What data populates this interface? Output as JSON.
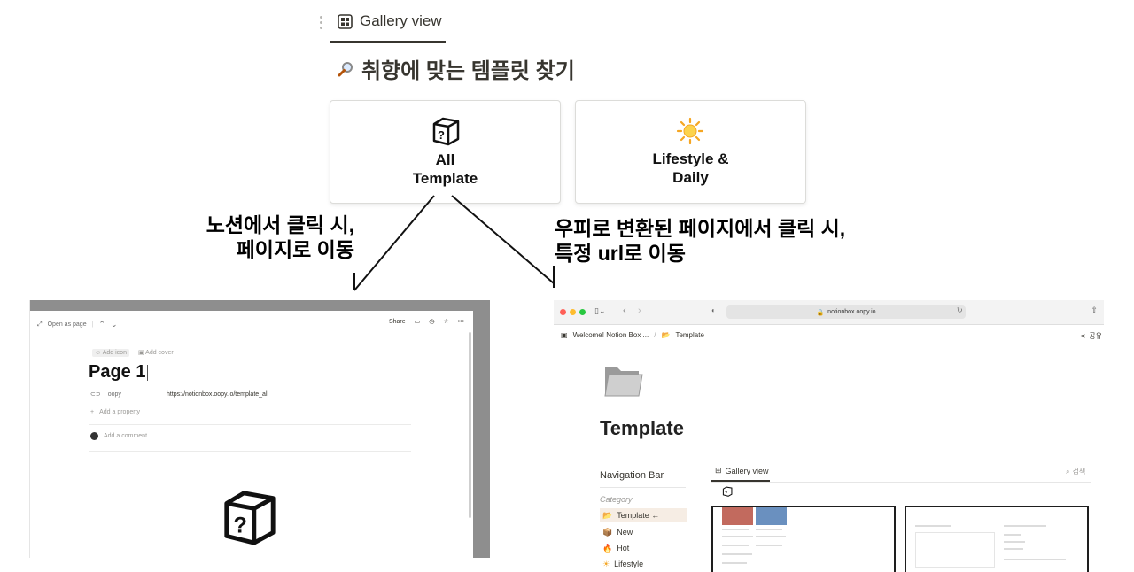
{
  "top": {
    "tab_label": "Gallery view",
    "heading_text": "취향에 맞는 템플릿 찾기",
    "cards": [
      {
        "label": "All\nTemplate",
        "icon": "question-box-icon"
      },
      {
        "label": "Lifestyle &\nDaily",
        "icon": "sun-icon"
      }
    ]
  },
  "annotations": {
    "left": "노션에서 클릭 시,\n페이지로 이동",
    "right": "우피로 변환된 페이지에서 클릭 시,\n특정 url로 이동"
  },
  "notion_peek": {
    "open_as_page": "Open as page",
    "share": "Share",
    "add_icon": "Add icon",
    "add_cover": "Add cover",
    "page_title": "Page 1",
    "property_name": "oopy",
    "property_value": "https://notionbox.oopy.io/template_all",
    "add_property": "Add a property",
    "add_comment": "Add a comment..."
  },
  "browser": {
    "url": "notionbox.oopy.io",
    "breadcrumb": [
      "Welcome! Notion Box ...",
      "Template"
    ],
    "breadcrumb_sep": "/",
    "share_label": "공유",
    "page_title": "Template",
    "nav_title": "Navigation Bar",
    "category_label": "Category",
    "nav_items": [
      {
        "label": "Template ←",
        "icon": "folder-icon",
        "active": true
      },
      {
        "label": "New",
        "icon": "box-icon",
        "active": false
      },
      {
        "label": "Hot",
        "icon": "fire-icon",
        "active": false
      },
      {
        "label": "Lifestyle",
        "icon": "sun-icon",
        "active": false
      }
    ],
    "gallery_tab": "Gallery view",
    "search_label": "검색"
  }
}
